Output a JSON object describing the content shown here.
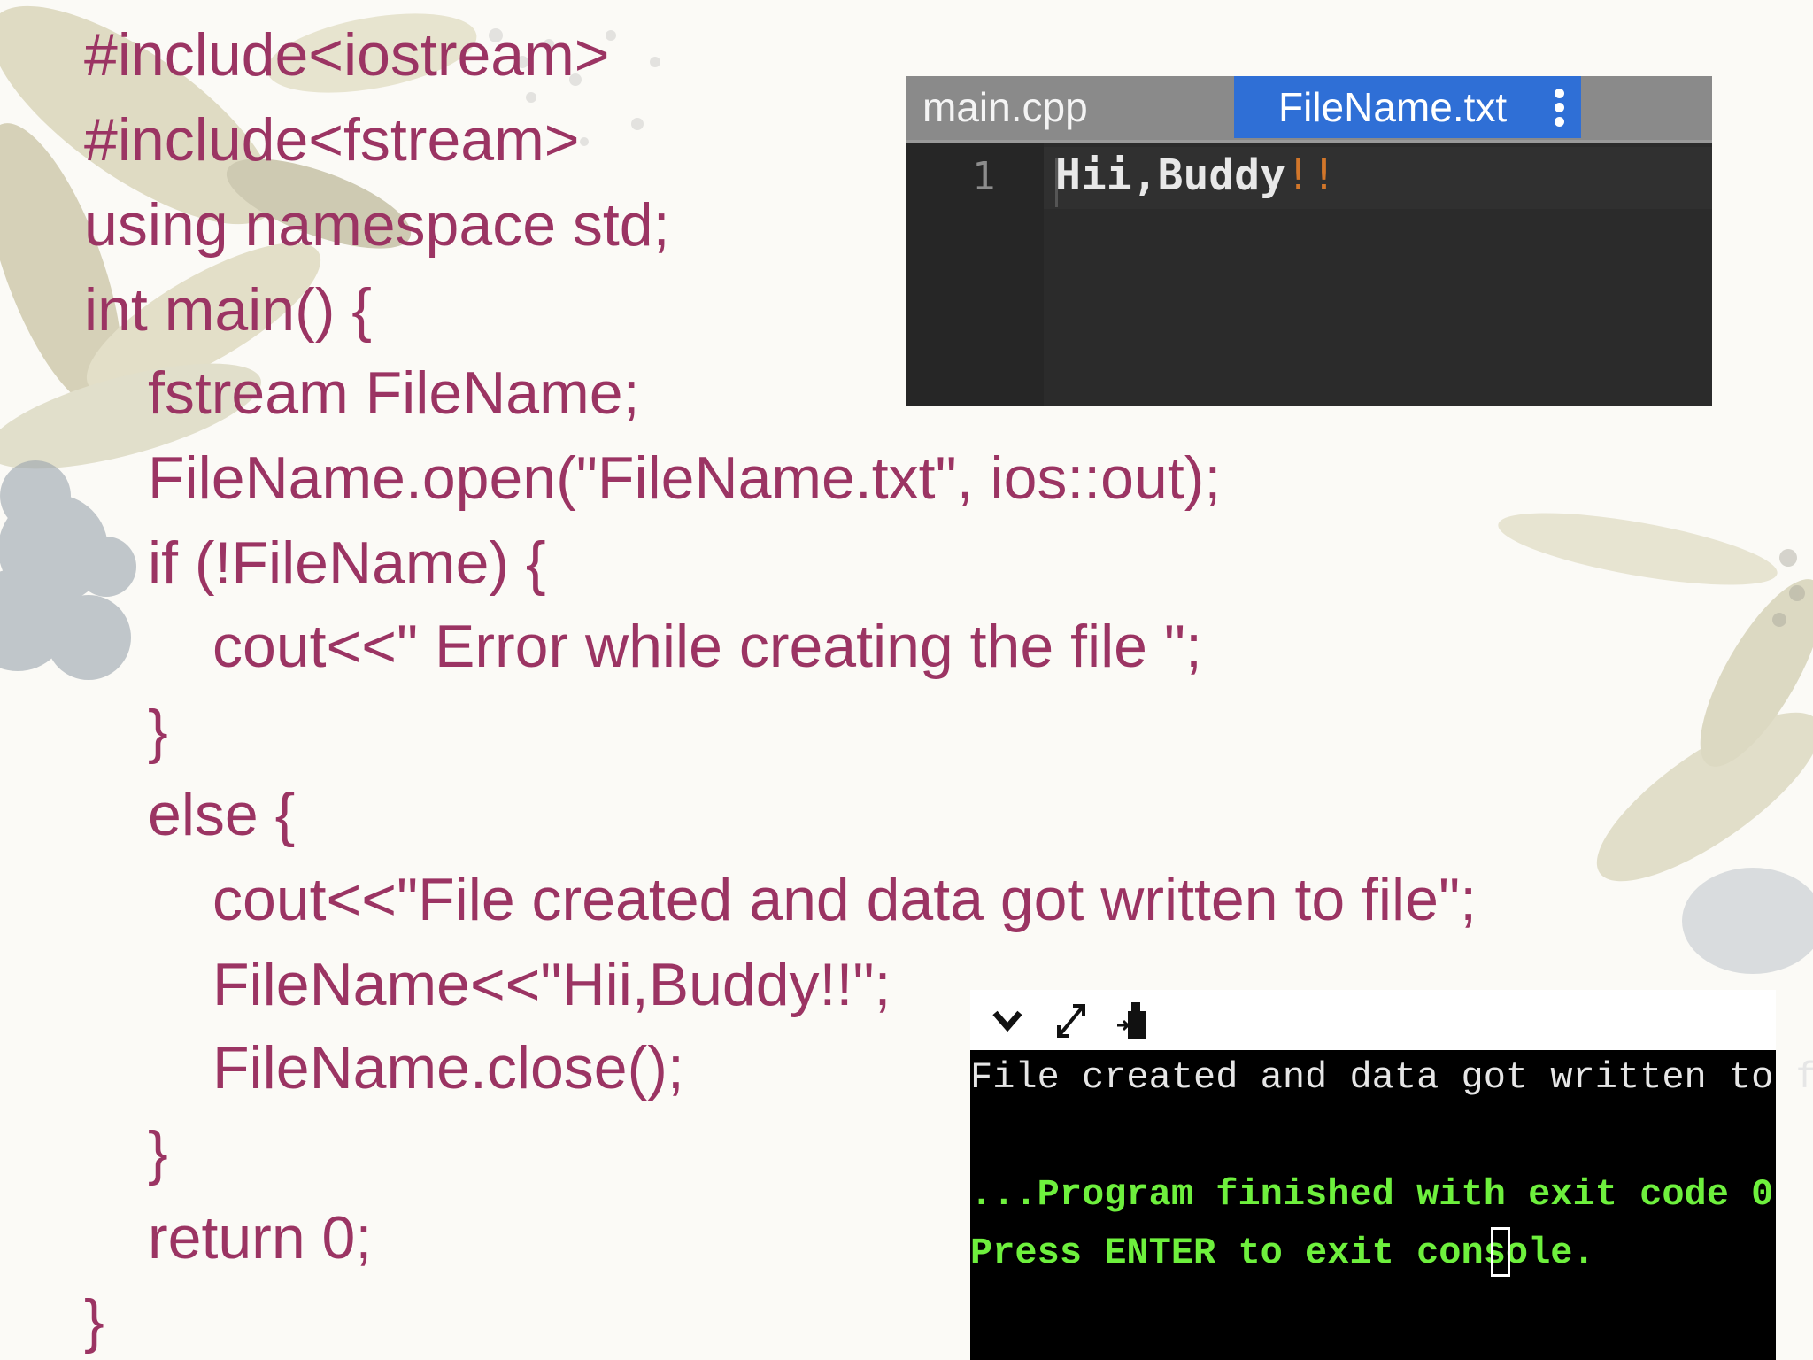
{
  "code_lines": [
    "#include<iostream>",
    "#include<fstream>",
    "using namespace std;",
    "int main() {",
    "fstream FileName;",
    "FileName.open(\"FileName.txt\", ios::out);",
    "if (!FileName) {",
    "cout<<\" Error while creating the file \";",
    "}",
    "else {",
    "cout<<\"File created and data got written to file\";",
    "FileName<<\"Hii,Buddy!!\";",
    "FileName.close();",
    "}",
    "return 0;",
    "}"
  ],
  "editor": {
    "tabs": [
      "main.cpp",
      "FileName.txt"
    ],
    "active_tab": "FileName.txt",
    "line_number": "1",
    "content": "Hii,Buddy",
    "content_suffix": "!!"
  },
  "console": {
    "output": "File created and data got written to file",
    "finished": "...Program finished with exit code 0",
    "prompt": "Press ENTER to exit console."
  },
  "colors": {
    "code_text": "#9b3463",
    "active_tab": "#2f6fd6",
    "console_green": "#6ef03d"
  },
  "icons": [
    "chevron-down-icon",
    "expand-icon",
    "stop-icon"
  ]
}
